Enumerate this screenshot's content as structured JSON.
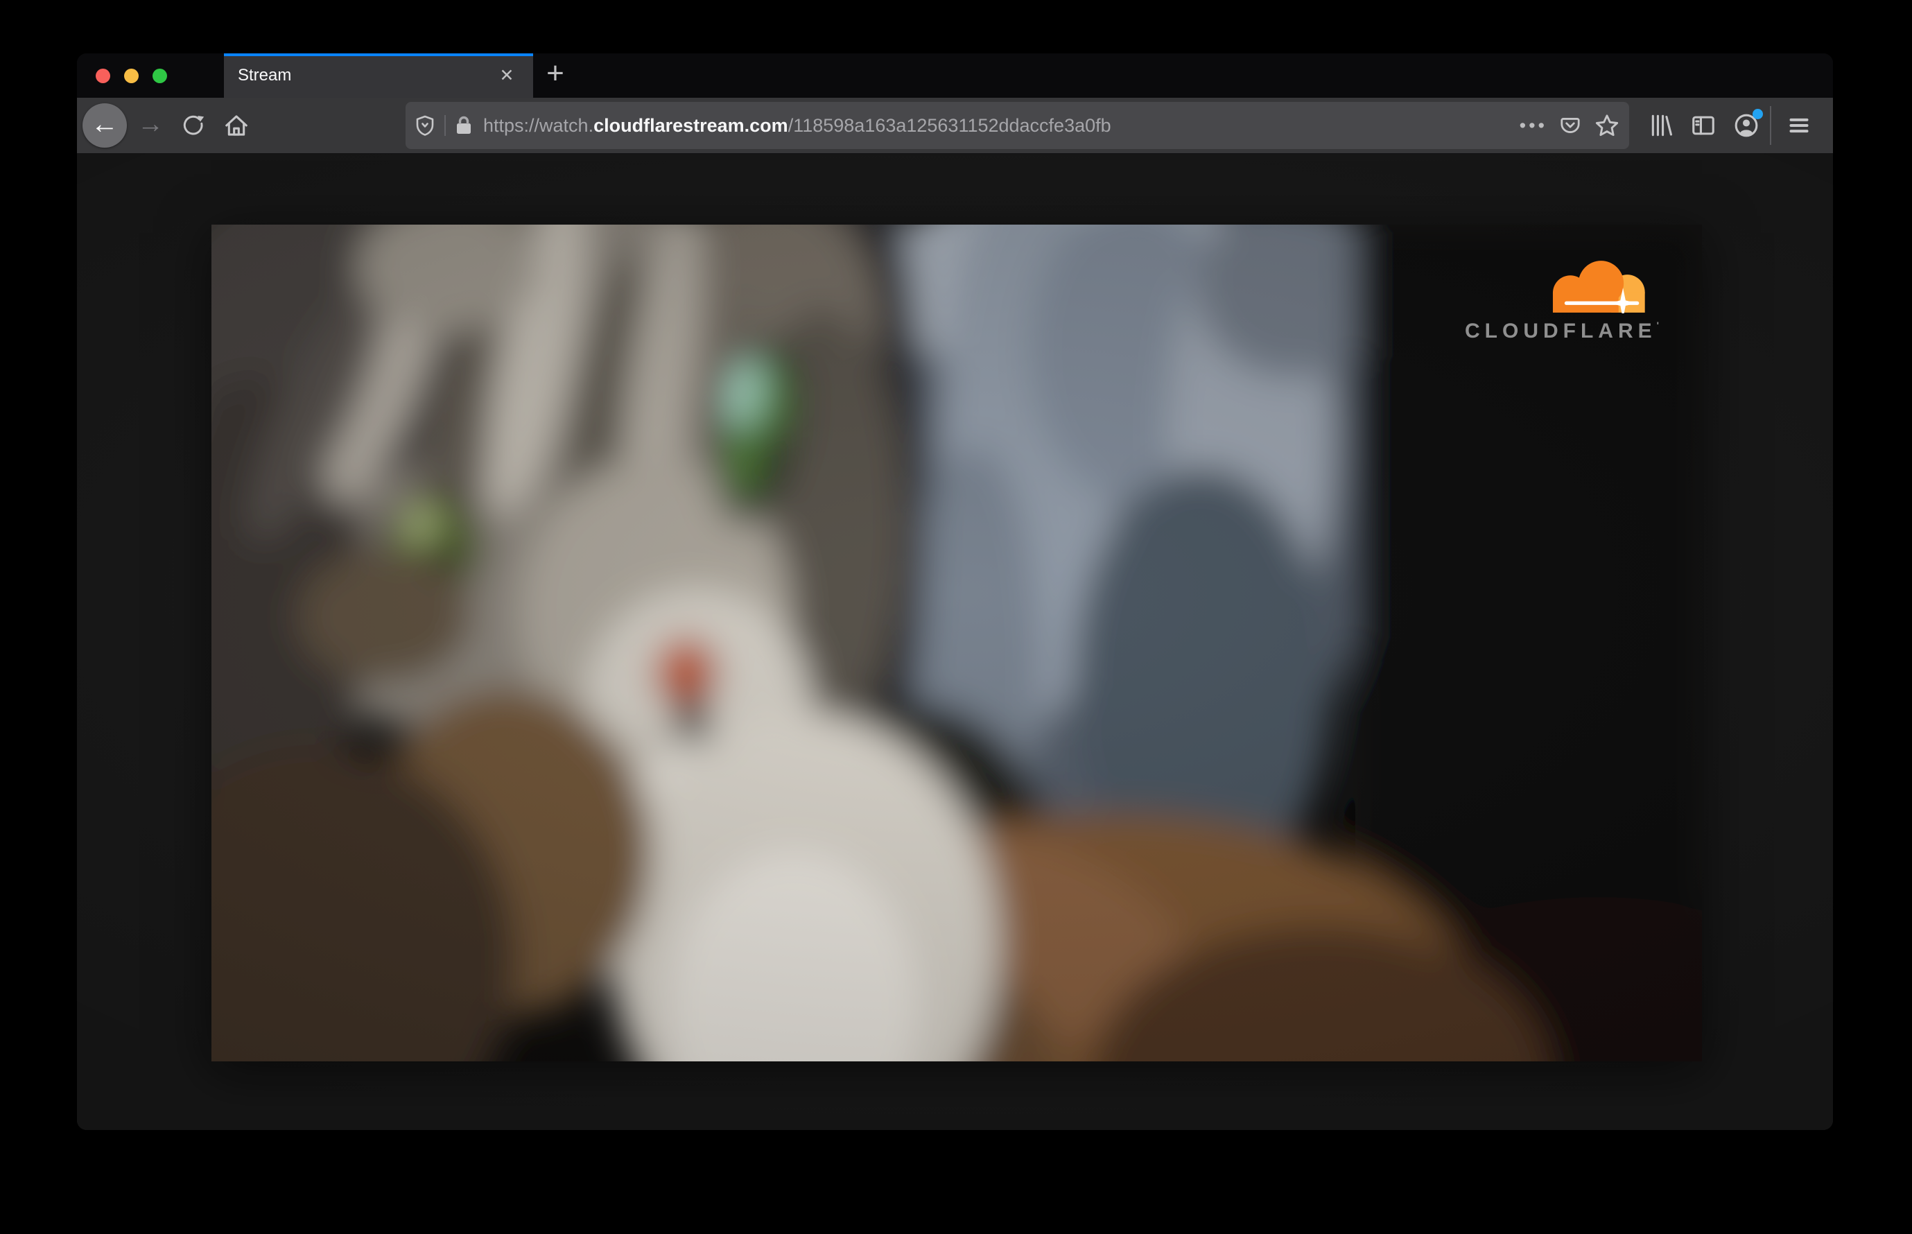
{
  "window": {
    "traffic_lights": {
      "close_color": "#f8605b",
      "minimize_color": "#f8bd45",
      "zoom_color": "#2fc745"
    }
  },
  "tab_bar": {
    "active_tab": {
      "title": "Stream",
      "close_glyph": "✕"
    },
    "new_tab_glyph": "+"
  },
  "toolbar": {
    "back_glyph": "←",
    "forward_glyph": "→",
    "page_actions_glyph": "•••",
    "url": {
      "scheme_and_subdomain": "https://watch.",
      "domain": "cloudflarestream.com",
      "path": "/118598a163a125631152ddaccfe3a0fb"
    },
    "icons": [
      "shield-icon",
      "lock-icon",
      "page-actions-icon",
      "pocket-icon",
      "bookmark-star-icon",
      "library-icon",
      "sidebar-icon",
      "account-icon",
      "menu-icon"
    ]
  },
  "video_player": {
    "description": "blurry close-up of a grey tabby cat with green eyes",
    "brand_text": "CLOUDFLARE",
    "brand_trademark": "'"
  },
  "colors": {
    "accent_blue": "#0a84ff",
    "profile_badge_blue": "#23a3f2",
    "cloudflare_orange": "#f6821f",
    "cloudflare_orange_light": "#fbad41",
    "toolbar_bg": "#373739",
    "urlbar_bg": "#48484b",
    "tabbar_bg": "#0a0a0c",
    "page_bg": "#191919"
  }
}
